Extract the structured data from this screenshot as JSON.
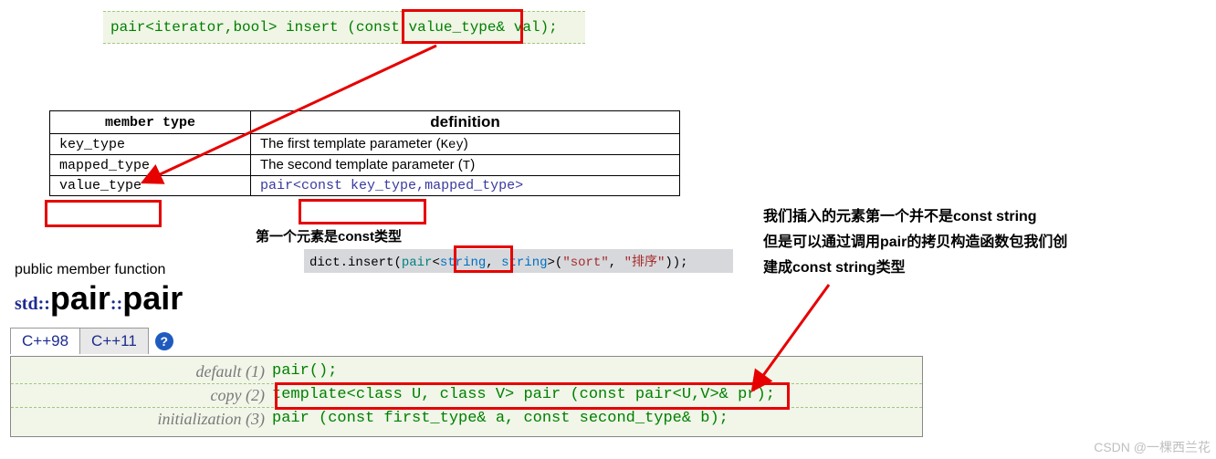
{
  "insert_proto": {
    "pair_open": "pair<",
    "iterator": "iterator",
    "comma": ",",
    "bool": "bool",
    "close": "> ",
    "insert": "insert ",
    "paren_open": "(",
    "const": "const ",
    "value_type_ref": "value_type&",
    "val": " val",
    "end": ");"
  },
  "mtable": {
    "hdr_member": "member type",
    "hdr_def": "definition",
    "rows": [
      {
        "name": "key_type",
        "def_pre": "The first template parameter (",
        "def_tt": "Key",
        "def_post": ")"
      },
      {
        "name": "mapped_type",
        "def_pre": "The second template parameter (",
        "def_tt": "T",
        "def_post": ")"
      },
      {
        "name": "value_type",
        "pair_open": "pair<",
        "ckt": "const key_type",
        "comma": ",",
        "mt": "mapped_type",
        "close": ">"
      }
    ]
  },
  "note_first_const": "第一个元素是const类型",
  "dict_code": {
    "lhs": "dict",
    "dot": ".",
    "method": "insert",
    "paren": "(",
    "pair": "pair",
    "lt": "<",
    "t1": "string",
    "comma": ", ",
    "t2": "string",
    "gt": ">",
    "paren2": "(",
    "s1": "\"sort\"",
    "comma2": ", ",
    "s2": "\"排序\"",
    "end": "));"
  },
  "pubmember": "public member function",
  "stdpair": {
    "prefix": "std::",
    "cls": "pair",
    "sep": "::",
    "ctor": "pair"
  },
  "tabs": {
    "t1": "C++98",
    "t2": "C++11"
  },
  "ctors": [
    {
      "label": "default (1)",
      "code": "pair();"
    },
    {
      "label": "copy (2)",
      "code": "template<class U, class V> pair (const pair<U,V>& pr);"
    },
    {
      "label": "initialization (3)",
      "code": "pair (const first_type& a, const second_type& b);"
    }
  ],
  "commentary": {
    "l1": "我们插入的元素第一个并不是const string",
    "l2": "但是可以通过调用pair的拷贝构造函数包我们创",
    "l3": "建成const string类型"
  },
  "watermark": "CSDN @一棵西兰花",
  "icons": {
    "help": "?"
  }
}
